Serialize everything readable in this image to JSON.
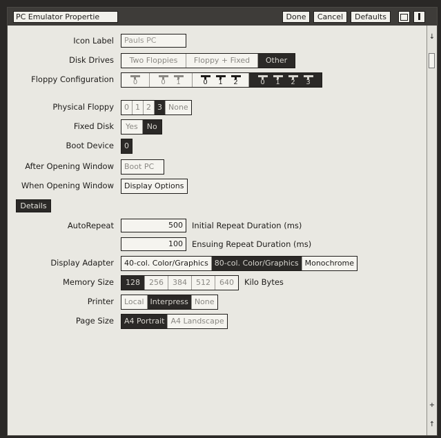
{
  "window": {
    "title": "PC Emulator Propertie",
    "buttons": {
      "done": "Done",
      "cancel": "Cancel",
      "defaults": "Defaults"
    }
  },
  "fields": {
    "icon_label": {
      "label": "Icon Label",
      "value": "Pauls PC"
    },
    "disk_drives": {
      "label": "Disk Drives",
      "options": [
        "Two Floppies",
        "Floppy + Fixed",
        "Other"
      ],
      "selected": "Other"
    },
    "floppy_configuration": {
      "label": "Floppy Configuration",
      "options": [
        [
          "0"
        ],
        [
          "0",
          "1"
        ],
        [
          "0",
          "1",
          "2"
        ],
        [
          "0",
          "1",
          "2",
          "3"
        ]
      ],
      "selected_index": 3
    },
    "physical_floppy": {
      "label": "Physical Floppy",
      "options": [
        "0",
        "1",
        "2",
        "3",
        "None"
      ],
      "selected": "3"
    },
    "fixed_disk": {
      "label": "Fixed Disk",
      "options": [
        "Yes",
        "No"
      ],
      "selected": "No"
    },
    "boot_device": {
      "label": "Boot Device",
      "value": "0"
    },
    "after_opening_window": {
      "label": "After Opening Window",
      "button": "Boot PC"
    },
    "when_opening_window": {
      "label": "When Opening Window",
      "button": "Display Options"
    },
    "details_button": "Details",
    "autorepeat": {
      "label": "AutoRepeat",
      "initial_value": "500",
      "initial_label": "Initial Repeat Duration (ms)",
      "ensuing_value": "100",
      "ensuing_label": "Ensuing Repeat Duration (ms)"
    },
    "display_adapter": {
      "label": "Display Adapter",
      "options": [
        "40-col. Color/Graphics",
        "80-col. Color/Graphics",
        "Monochrome"
      ],
      "selected": "80-col. Color/Graphics"
    },
    "memory_size": {
      "label": "Memory Size",
      "options": [
        "128",
        "256",
        "384",
        "512",
        "640"
      ],
      "selected": "128",
      "unit": "Kilo Bytes"
    },
    "printer": {
      "label": "Printer",
      "options": [
        "Local",
        "Interpress",
        "None"
      ],
      "selected": "Interpress"
    },
    "page_size": {
      "label": "Page Size",
      "options": [
        "A4 Portrait",
        "A4 Landscape"
      ],
      "selected": "A4 Portrait"
    }
  }
}
